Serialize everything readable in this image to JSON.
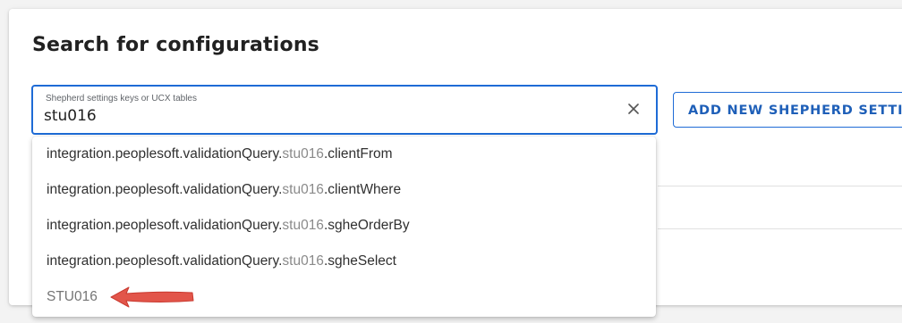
{
  "panel": {
    "title": "Search for configurations"
  },
  "search": {
    "label": "Shepherd settings keys or UCX tables",
    "value": "stu016"
  },
  "add_button": {
    "label": "ADD NEW SHEPHERD SETTING"
  },
  "suggestions": [
    {
      "prefix": "integration.peoplesoft.validationQuery.",
      "match": "stu016",
      "suffix": ".clientFrom"
    },
    {
      "prefix": "integration.peoplesoft.validationQuery.",
      "match": "stu016",
      "suffix": ".clientWhere"
    },
    {
      "prefix": "integration.peoplesoft.validationQuery.",
      "match": "stu016",
      "suffix": ".sgheOrderBy"
    },
    {
      "prefix": "integration.peoplesoft.validationQuery.",
      "match": "stu016",
      "suffix": ".sgheSelect"
    }
  ],
  "table_suggestion": "STU016",
  "icons": {
    "clear": "close-icon",
    "annotation": "red-arrow-icon"
  },
  "colors": {
    "accent": "#1e6bd6",
    "button_text": "#1e5fb8",
    "arrow": "#e2554a"
  }
}
